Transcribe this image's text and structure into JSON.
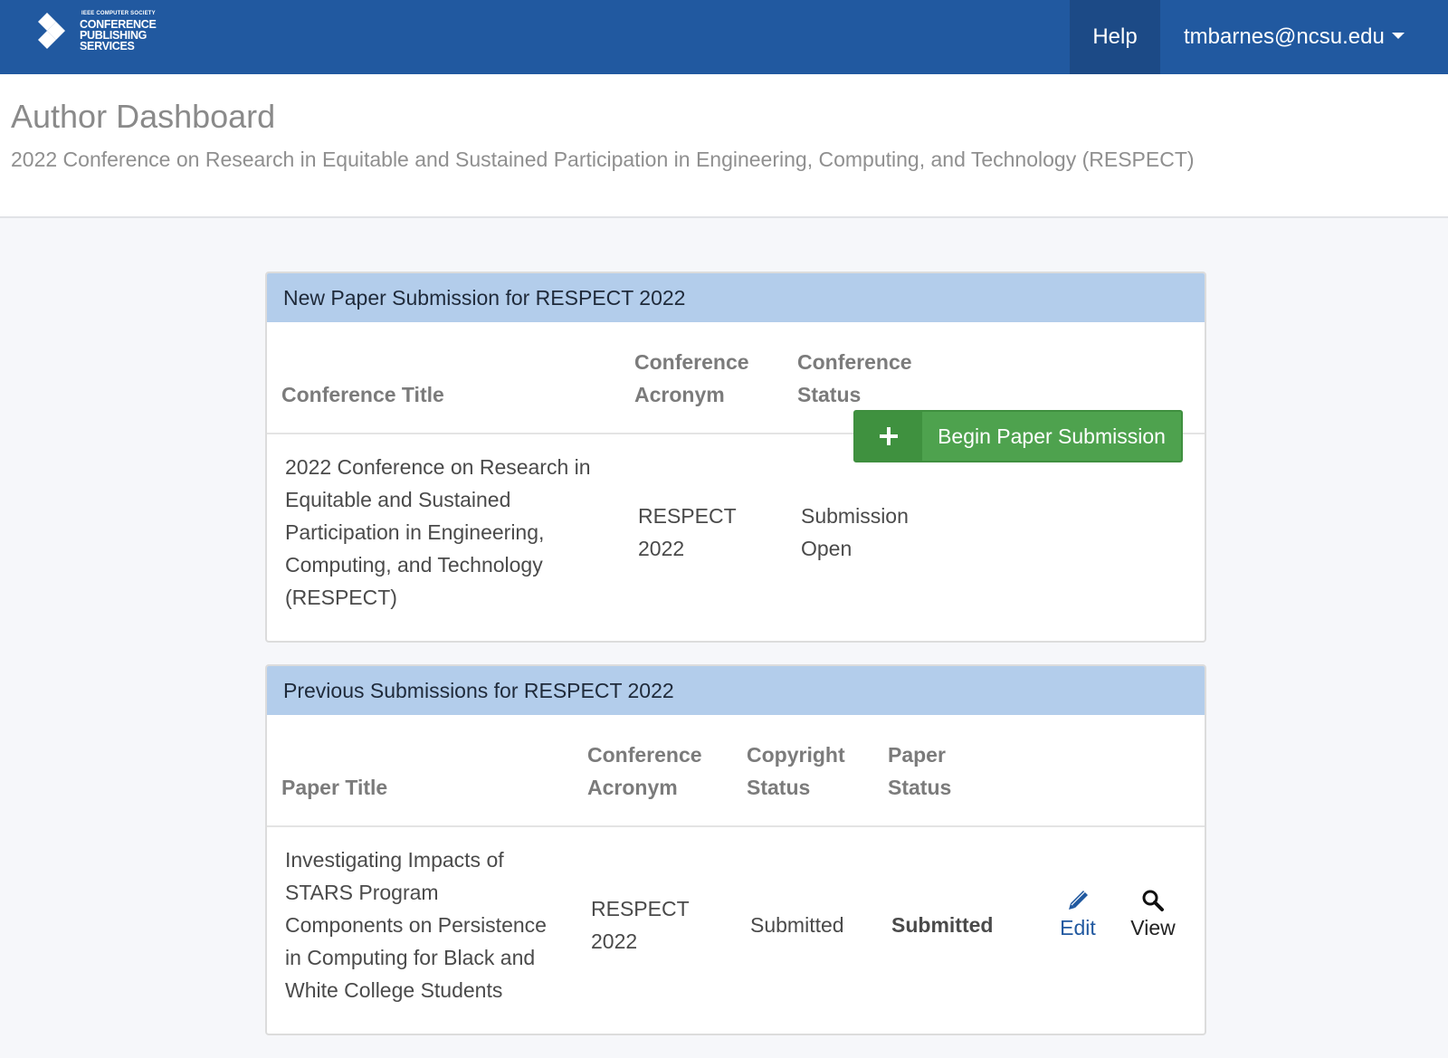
{
  "navbar": {
    "logo_small": "IEEE COMPUTER SOCIETY",
    "logo_lines": [
      "CONFERENCE",
      "PUBLISHING",
      "SERVICES"
    ],
    "help_label": "Help",
    "user_email": "tmbarnes@ncsu.edu",
    "bg_color": "#2159a0"
  },
  "header": {
    "title": "Author Dashboard",
    "subtitle": "2022 Conference on Research in Equitable and Sustained Participation in Engineering, Computing, and Technology (RESPECT)"
  },
  "new_submission": {
    "heading": "New Paper Submission for RESPECT 2022",
    "columns": {
      "title": "Conference Title",
      "acronym": [
        "Conference",
        "Acronym"
      ],
      "status": [
        "Conference",
        "Status"
      ]
    },
    "row": {
      "title_lines": [
        "2022 Conference on Research in",
        "Equitable and Sustained",
        "Participation in Engineering,",
        "Computing, and Technology",
        "(RESPECT)"
      ],
      "acronym_lines": [
        "RESPECT",
        "2022"
      ],
      "status_lines": [
        "Submission",
        "Open"
      ]
    },
    "begin_button_label": "Begin Paper Submission",
    "button_icon": "plus-icon",
    "button_color": "#4ea24e"
  },
  "previous_submissions": {
    "heading": "Previous Submissions for RESPECT 2022",
    "columns": {
      "title": "Paper Title",
      "acronym": [
        "Conference",
        "Acronym"
      ],
      "copyright": [
        "Copyright",
        "Status"
      ],
      "paper_status": [
        "Paper",
        "Status"
      ]
    },
    "row": {
      "title_lines": [
        "Investigating Impacts of",
        "STARS Program",
        "Components on Persistence",
        "in Computing for Black and",
        "White College Students"
      ],
      "acronym_lines": [
        "RESPECT",
        "2022"
      ],
      "copyright_status": "Submitted",
      "paper_status": "Submitted",
      "edit_label": "Edit",
      "edit_icon": "pencil-icon",
      "view_label": "View",
      "view_icon": "magnifier-icon"
    }
  }
}
